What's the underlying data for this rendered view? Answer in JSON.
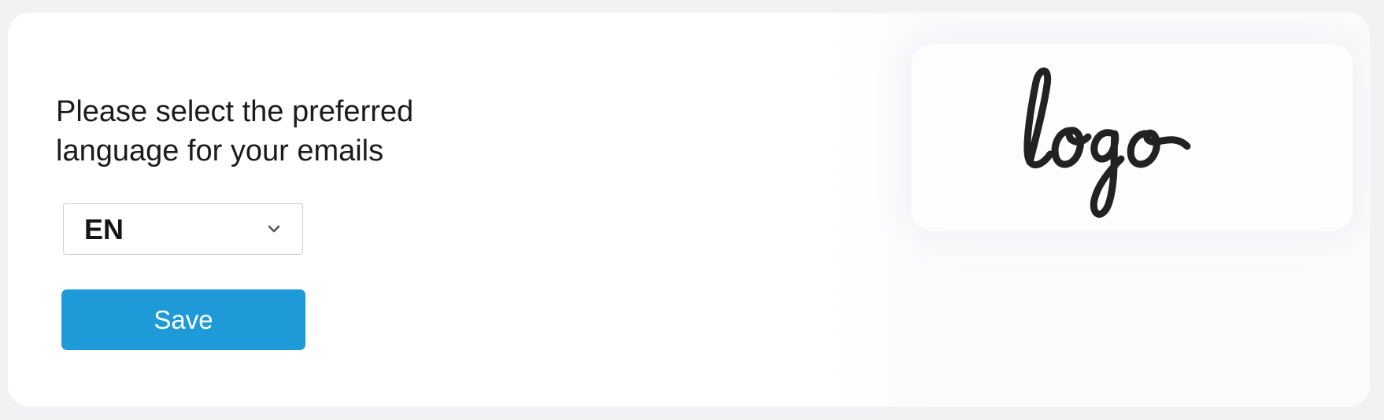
{
  "form": {
    "prompt": "Please select the preferred language for your emails",
    "language_select": {
      "value": "EN",
      "icon": "chevron-down-icon"
    },
    "save_label": "Save"
  },
  "logo": {
    "text": "logo"
  },
  "colors": {
    "page_background": "#f2f2f4",
    "card_background": "#ffffff",
    "button_blue": "#1e9ad8",
    "text": "#1b1b1b"
  }
}
